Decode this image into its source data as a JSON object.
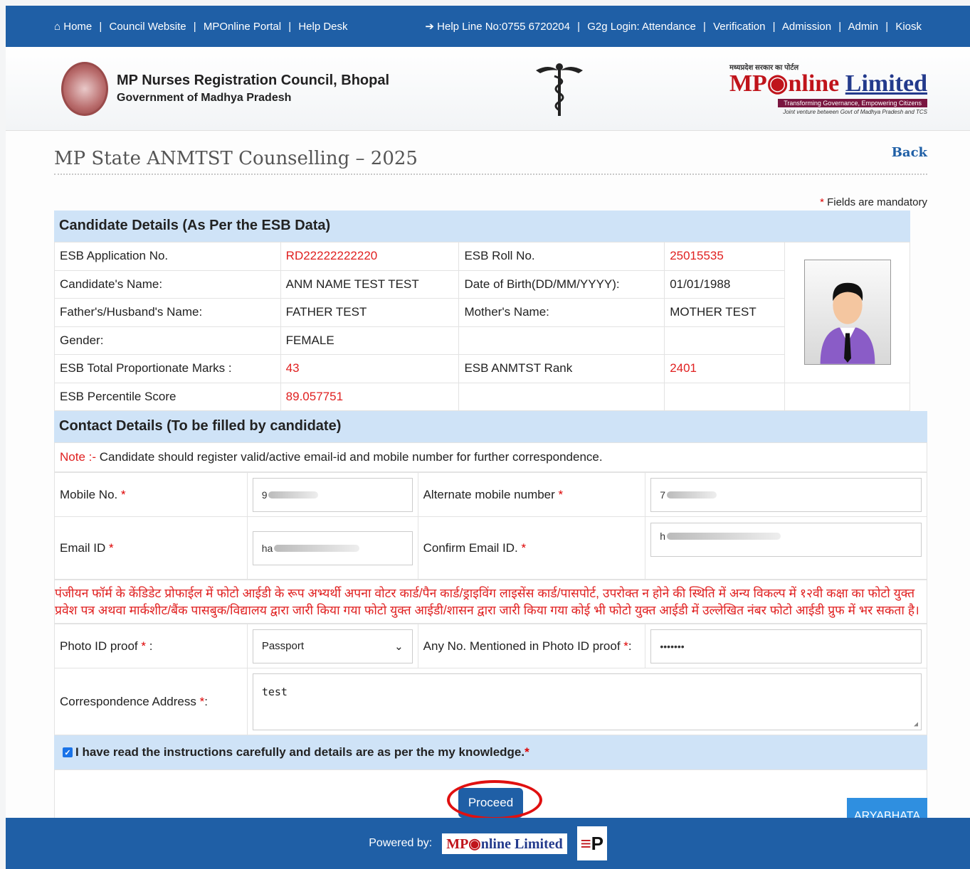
{
  "topbar": {
    "home": "Home",
    "council_website": "Council Website",
    "mponline_portal": "MPOnline Portal",
    "help_desk": "Help Desk",
    "helpline": "Help Line No:0755 6720204",
    "g2g_login": "G2g Login: Attendance",
    "verification": "Verification",
    "admission": "Admission",
    "admin": "Admin",
    "kiosk": "Kiosk"
  },
  "header": {
    "org_name": "MP Nurses Registration Council, Bhopal",
    "org_sub": "Government of Madhya Pradesh",
    "mponline_small": "मध्यप्रदेश सरकार का पोर्टल",
    "mponline_mp": "MP",
    "mponline_nline": "nline",
    "mponline_limited": "Limited",
    "mponline_tag": "Transforming Governance, Empowering Citizens",
    "mponline_tag2": "Joint venture between Govt of Madhya Pradesh and TCS"
  },
  "page": {
    "title": "MP State ANMTST Counselling – 2025",
    "back": "Back",
    "mandatory_star": "*",
    "mandatory_text": "Fields are mandatory"
  },
  "candidate": {
    "section_title": "Candidate Details (As Per the ESB Data)",
    "app_no_label": "ESB Application No.",
    "app_no": "RD22222222220",
    "roll_label": "ESB Roll No.",
    "roll": "25015535",
    "name_label": "Candidate's Name:",
    "name": "ANM NAME TEST TEST",
    "dob_label": "Date of Birth(DD/MM/YYYY):",
    "dob": "01/01/1988",
    "father_label": "Father's/Husband's Name:",
    "father": "FATHER TEST",
    "mother_label": "Mother's Name:",
    "mother": "MOTHER TEST",
    "gender_label": "Gender:",
    "gender": "FEMALE",
    "marks_label": "ESB Total Proportionate Marks :",
    "marks": "43",
    "rank_label": "ESB ANMTST Rank",
    "rank": "2401",
    "percentile_label": "ESB Percentile Score",
    "percentile": "89.057751"
  },
  "contact": {
    "section_title": "Contact Details (To be filled by candidate)",
    "note_prefix": "Note :-",
    "note_text": "Candidate should register valid/active email-id and mobile number for further correspondence.",
    "mobile_label": "Mobile No.",
    "mobile_value": "9",
    "alt_mobile_label": "Alternate mobile number",
    "alt_mobile_value": "7",
    "email_label": "Email ID",
    "email_value": "ha",
    "confirm_email_label": "Confirm Email ID.",
    "confirm_email_value": "h",
    "hindi_note": "पंजीयन फॉर्म के केंडिडेट प्रोफाईल में फोटो आईडी के रूप अभ्यर्थी अपना वोटर कार्ड/पैन कार्ड/ड्राइविंग लाइसेंस कार्ड/पासपोर्ट, उपरोक्त न होने की स्थिति में अन्य विकल्प में १२वी कक्षा का फोटो युक्त प्रवेश पत्र अथवा मार्कशीट/बैंक पासबुक/विद्यालय द्वारा जारी किया गया फोटो युक्त आईडी/शासन द्वारा जारी किया गया कोई भी फोटो युक्त आईडी में उल्लेखित नंबर फोटो आईडी प्रुफ में भर सकता है।",
    "photo_id_label": "Photo ID proof",
    "photo_id_value": "Passport",
    "photo_no_label": "Any No. Mentioned in Photo ID proof",
    "photo_no_value": "•••••••",
    "address_label": "Correspondence Address",
    "address_value": "test",
    "declaration": "I have read the instructions carefully and details are as per the my knowledge.",
    "req": "*"
  },
  "actions": {
    "proceed": "Proceed",
    "aryabhata": "ARYABHATA"
  },
  "footer": {
    "powered_by": "Powered by:",
    "mp": "MP",
    "nline_limited": "nline Limited",
    "erp": "P"
  },
  "colors": {
    "primary": "#1f5fa6",
    "section_bg": "#cfe3f7",
    "value_red": "#e02020"
  }
}
